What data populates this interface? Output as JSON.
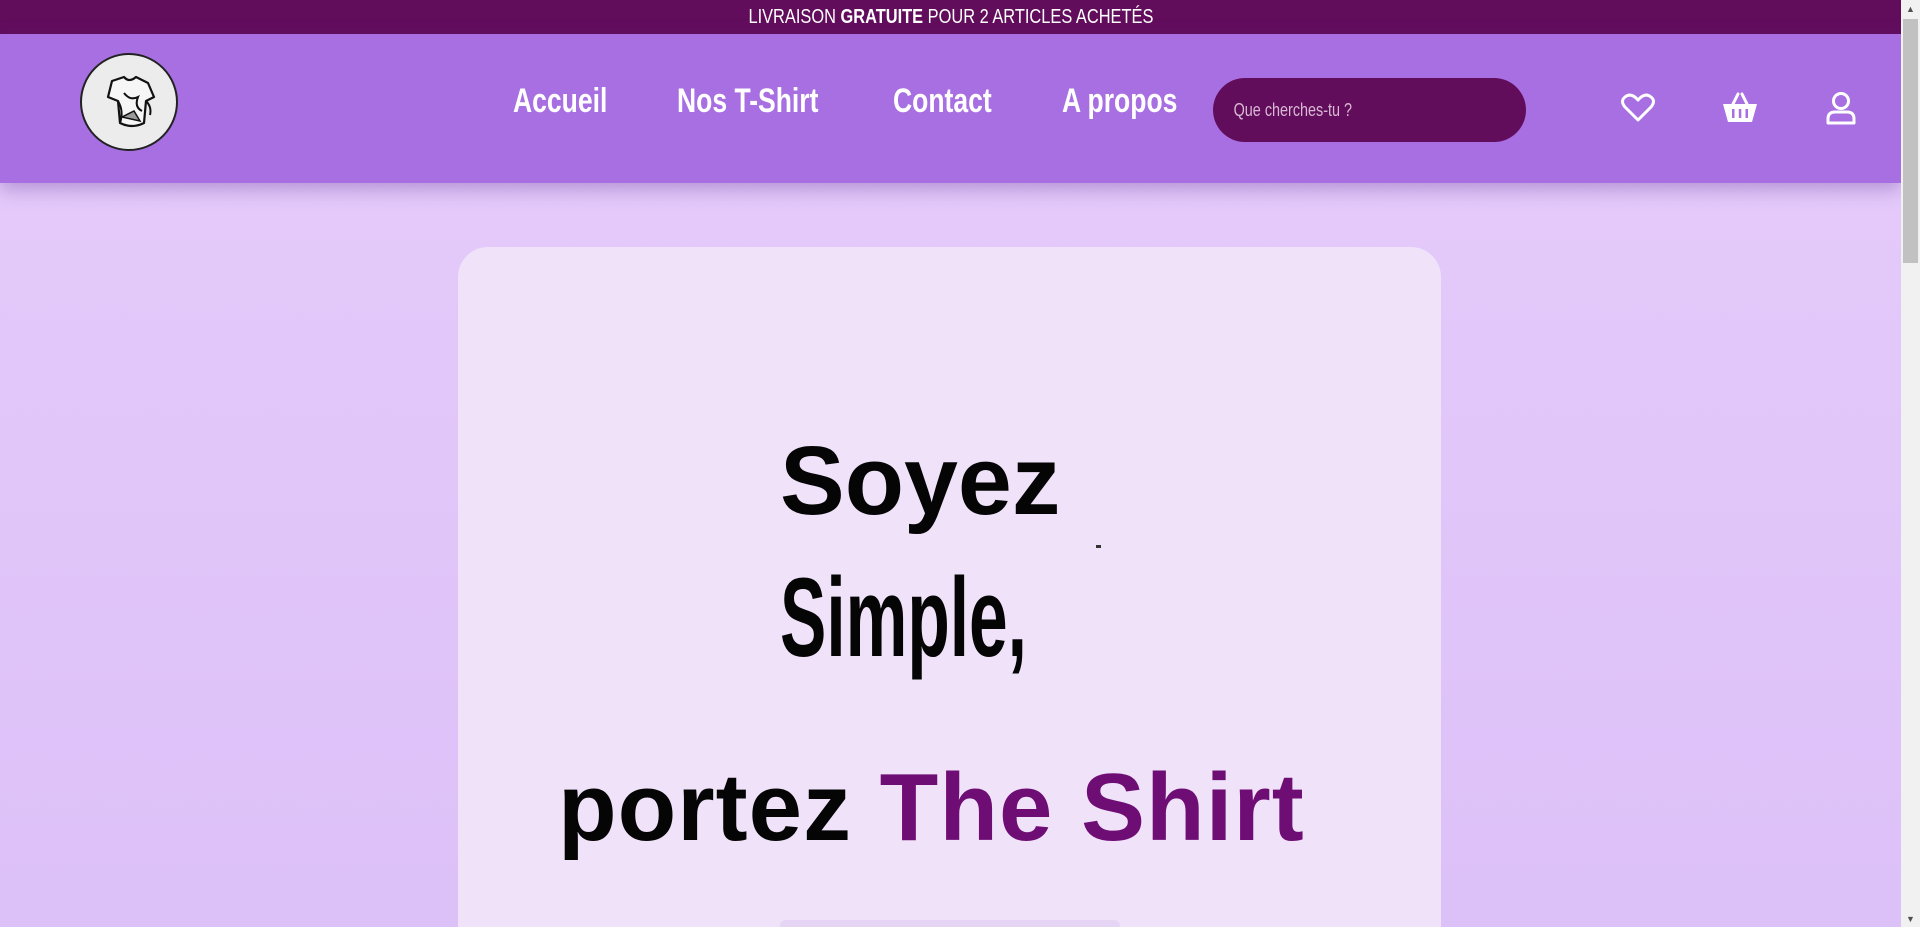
{
  "promo": {
    "prefix": "LIVRAISON ",
    "highlight": "GRATUITE",
    "suffix": " POUR 2 ARTICLES ACHETÉS"
  },
  "nav": {
    "items": [
      {
        "label": "Accueil"
      },
      {
        "label": "Nos T-Shirt"
      },
      {
        "label": "Contact"
      },
      {
        "label": "A propos"
      }
    ]
  },
  "search": {
    "placeholder": "Que cherches-tu ?",
    "value": ""
  },
  "header_icons": [
    "heart-icon",
    "basket-icon",
    "user-icon"
  ],
  "hero": {
    "line1": "Soyez",
    "line2": "Simple,",
    "line3_dark": "portez ",
    "line3_accent": "The Shirt"
  },
  "colors": {
    "promo_bg": "#620d5c",
    "header_bg": "#a76fe2",
    "search_bg": "#620d5c",
    "page_bg": "#e6ccfb",
    "card_bg": "#efe2f9",
    "accent": "#6e0d74"
  }
}
